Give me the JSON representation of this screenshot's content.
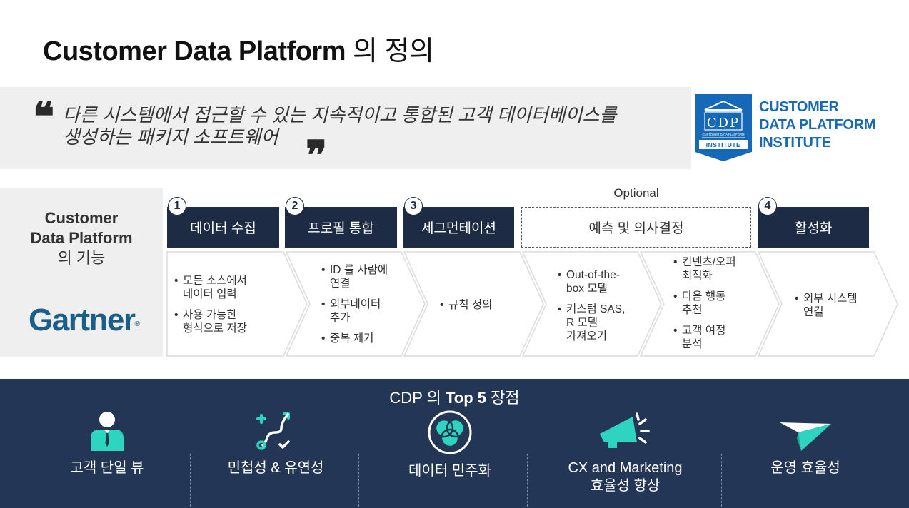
{
  "title": {
    "main": "Customer Data Platform",
    "suffix": "의 정의"
  },
  "quote": {
    "open_mark": "❝",
    "close_mark": "❞",
    "line1": "다른 시스템에서 접근할 수 있는 지속적이고 통합된 고객 데이터베이스를",
    "line2": "생성하는 패키지 소프트웨어"
  },
  "cdp_institute": {
    "badge_text": "CDP",
    "badge_sub": "CUSTOMER DATA PLATFORM",
    "badge_banner": "INSTITUTE",
    "name_line1": "CUSTOMER",
    "name_line2": "DATA PLATFORM",
    "name_line3": "INSTITUTE",
    "color": "#1668b8"
  },
  "functions": {
    "title_line1": "Customer",
    "title_line2": "Data Platform",
    "title_line3": "의 기능",
    "gartner": "Gartner",
    "gartner_mark": "®",
    "optional_label": "Optional",
    "steps": [
      {
        "number": "1",
        "label": "데이터 수집",
        "bullets": [
          [
            "모든 소스에서",
            "데이터 입력"
          ],
          [
            "사용 가능한",
            "형식으로 저장"
          ]
        ]
      },
      {
        "number": "2",
        "label": "프로필 통합",
        "bullets": [
          [
            "ID 를 사람에",
            "연결"
          ],
          [
            "외부데이터",
            "추가"
          ],
          [
            "중복 제거"
          ]
        ]
      },
      {
        "number": "3",
        "label": "세그먼테이션",
        "bullets": [
          [
            "규칙 정의"
          ]
        ]
      },
      {
        "number": "",
        "label": "예측 및 의사결정",
        "optional": true,
        "bullets_a": [
          [
            "Out-of-the-",
            "box 모델"
          ],
          [
            "커스텀 SAS,",
            "R 모델",
            "가져오기"
          ]
        ],
        "bullets_b": [
          [
            "컨넨츠/오퍼",
            "최적화"
          ],
          [
            "다음 행동",
            "추천"
          ],
          [
            "고객 여정",
            "분석"
          ]
        ]
      },
      {
        "number": "4",
        "label": "활성화",
        "bullets": [
          [
            "외부 시스템",
            "연결"
          ]
        ]
      }
    ]
  },
  "advantages": {
    "title_prefix": "CDP 의 ",
    "title_bold": "Top 5",
    "title_suffix": " 장점",
    "items": [
      {
        "icon": "single-customer-icon",
        "label_line1": "고객 단일 뷰",
        "label_line2": ""
      },
      {
        "icon": "agility-path-icon",
        "label_line1": "민첩성 & 유연성",
        "label_line2": ""
      },
      {
        "icon": "data-democratization-icon",
        "label_line1": "데이터 민주화",
        "label_line2": ""
      },
      {
        "icon": "megaphone-icon",
        "label_line1": "CX and Marketing",
        "label_line2": "효율성 향상"
      },
      {
        "icon": "paper-plane-icon",
        "label_line1": "운영 효율성",
        "label_line2": ""
      }
    ],
    "accent": "#2dd4c0",
    "band_color": "#243656"
  }
}
